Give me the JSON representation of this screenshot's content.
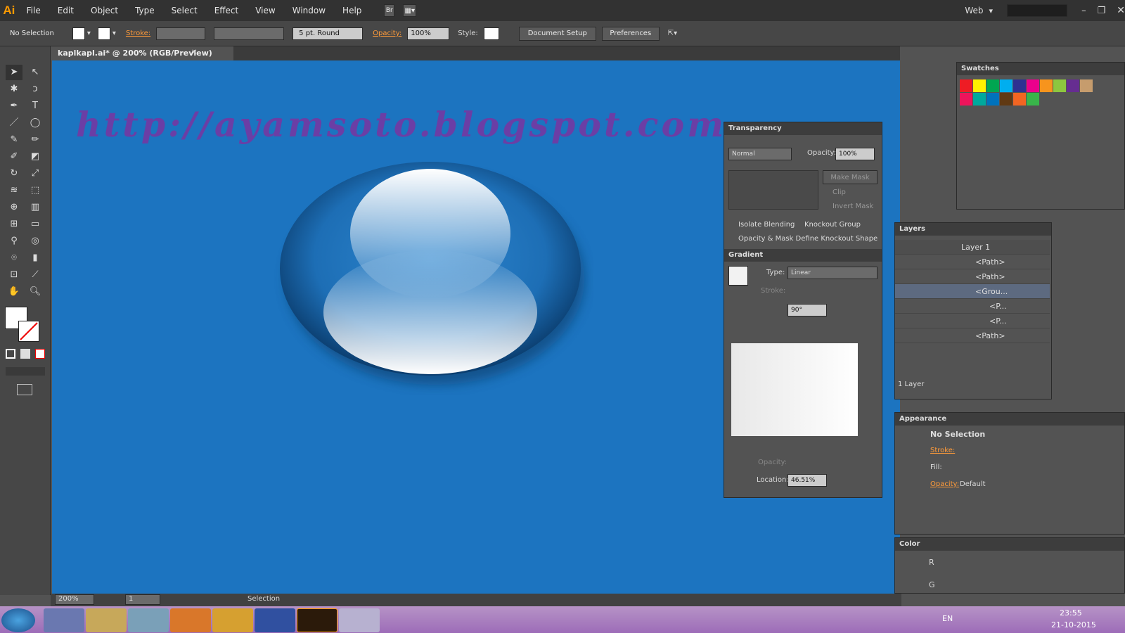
{
  "app": {
    "logo": "Ai",
    "menus": [
      "File",
      "Edit",
      "Object",
      "Type",
      "Select",
      "Effect",
      "View",
      "Window",
      "Help"
    ],
    "bridge": "Br",
    "workspace": "Web"
  },
  "control": {
    "selection": "No Selection",
    "stroke_label": "Stroke:",
    "brush": "5 pt. Round",
    "opacity_label": "Opacity:",
    "opacity": "100%",
    "style_label": "Style:",
    "doc_setup": "Document Setup",
    "preferences": "Preferences"
  },
  "document": {
    "tab_title": "kaplkapl.ai* @ 200% (RGB/Preview)",
    "url_text": "http://ayamsoto.blogspot.com"
  },
  "transparency": {
    "title": "Transparency",
    "blend": "Normal",
    "opacity_label": "Opacity:",
    "opacity": "100%",
    "make_mask": "Make Mask",
    "clip": "Clip",
    "invert_mask": "Invert Mask",
    "isolate": "Isolate Blending",
    "knockout": "Knockout Group",
    "opacity_mask": "Opacity & Mask Define Knockout Shape"
  },
  "gradient": {
    "title": "Gradient",
    "type_label": "Type:",
    "type": "Linear",
    "stroke_label": "Stroke:",
    "angle": "90°",
    "opacity_label": "Opacity:",
    "location_label": "Location:",
    "location": "46.51%"
  },
  "swatches": {
    "title": "Swatches",
    "colors": [
      "#ee1c24",
      "#fff200",
      "#00a651",
      "#00aeef",
      "#2e3192",
      "#ec008c",
      "#f7941d",
      "#8dc63f",
      "#662d91",
      "#c69c6d",
      "#ed145b",
      "#00a99d",
      "#0072bc",
      "#603913",
      "#f26522",
      "#39b54a"
    ]
  },
  "layers": {
    "title": "Layers",
    "items": [
      "Layer 1",
      "<Path>",
      "<Path>",
      "<Grou...",
      "<P...",
      "<P...",
      "<Path>"
    ],
    "count": "1 Layer"
  },
  "appearance": {
    "title": "Appearance",
    "selection": "No Selection",
    "stroke": "Stroke:",
    "fill": "Fill:",
    "opacity": "Opacity:",
    "opacity_value": "Default"
  },
  "color": {
    "title": "Color",
    "r": "R",
    "g": "G"
  },
  "status": {
    "zoom": "200%",
    "page": "1",
    "tool": "Selection"
  },
  "tray": {
    "lang": "EN",
    "time": "23:55",
    "date": "21-10-2015"
  }
}
